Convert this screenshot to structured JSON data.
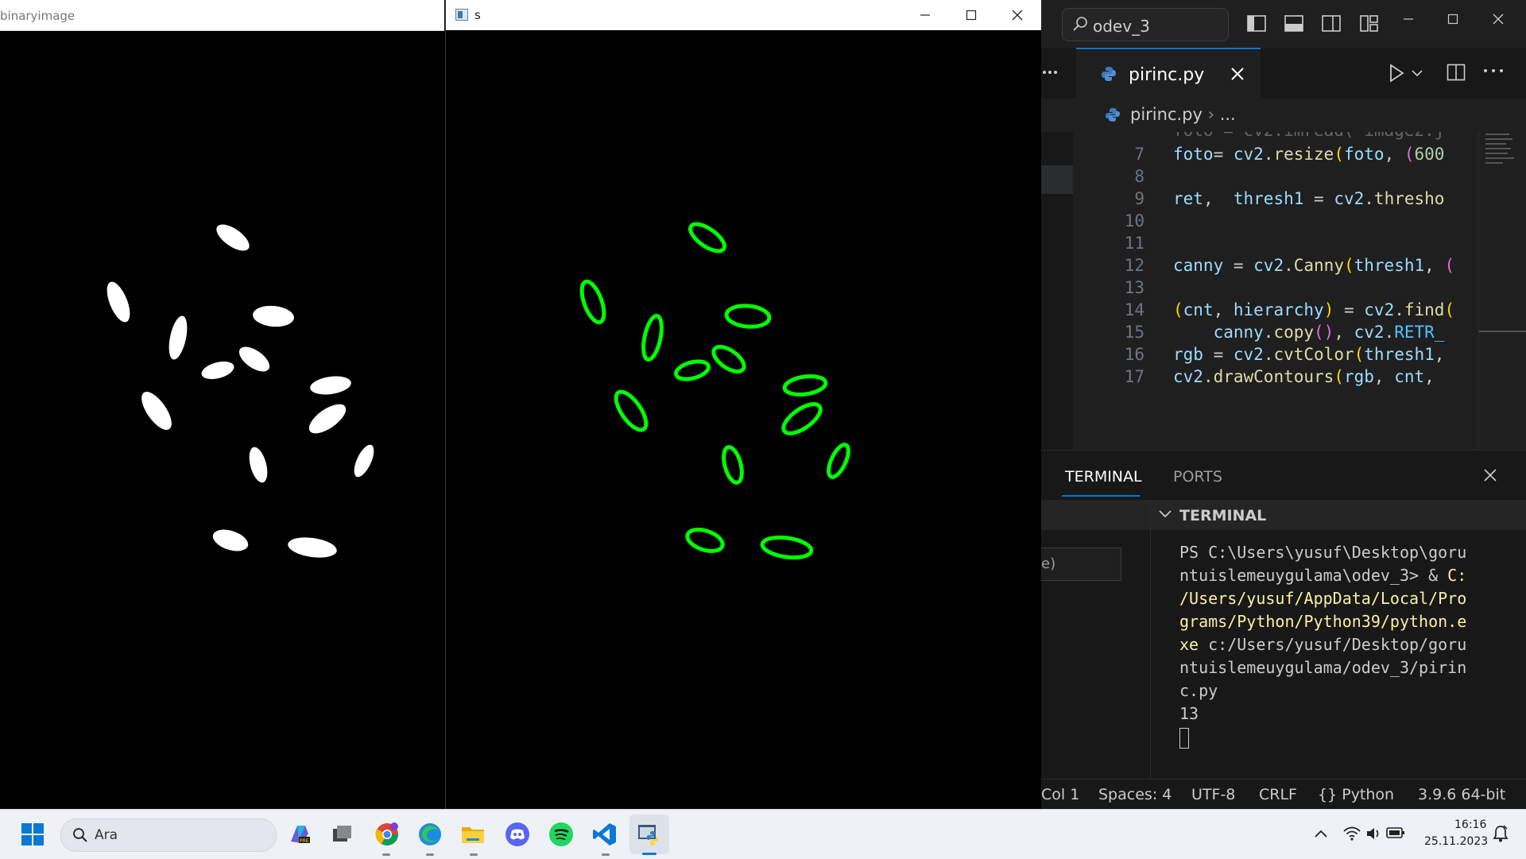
{
  "binary_window": {
    "title": "binaryimage"
  },
  "contour_window": {
    "title": "s"
  },
  "vscode": {
    "search": "odev_3",
    "tab": {
      "label": "pirinc.py"
    },
    "breadcrumb": {
      "file": "pirinc.py",
      "more": "..."
    },
    "code_lines": [
      {
        "num": "7",
        "text": "foto= cv2.resize(foto, (600"
      },
      {
        "num": "8",
        "text": ""
      },
      {
        "num": "9",
        "text": "ret,  thresh1 = cv2.thresho"
      },
      {
        "num": "10",
        "text": ""
      },
      {
        "num": "11",
        "text": ""
      },
      {
        "num": "12",
        "text": "canny = cv2.Canny(thresh1, ("
      },
      {
        "num": "13",
        "text": ""
      },
      {
        "num": "14",
        "text": "(cnt, hierarchy) = cv2.find("
      },
      {
        "num": "15",
        "text": "    canny.copy(), cv2.RETR_"
      },
      {
        "num": "16",
        "text": "rgb = cv2.cvtColor(thresh1,"
      },
      {
        "num": "17",
        "text": "cv2.drawContours(rgb, cnt, "
      }
    ],
    "panel_tabs": [
      "TERMINAL",
      "PORTS"
    ],
    "terminal_header": "TERMINAL",
    "terminal": {
      "l1": "PS C:\\Users\\yusuf\\Desktop\\goru",
      "l2a": "ntuislemeuygulama\\odev_3> & ",
      "l2b": "C:",
      "l3": "/Users/yusuf/AppData/Local/Pro",
      "l4": "grams/Python/Python39/python.e",
      "l5a": "xe",
      "l5b": " c:/Users/yusuf/Desktop/goru",
      "l6": "ntuislemeuygulama/odev_3/pirin",
      "l7": "c.py",
      "l8": "13"
    },
    "side_input": "e)",
    "status": {
      "col": "Col 1",
      "spaces": "Spaces: 4",
      "encoding": "UTF-8",
      "eol": "CRLF",
      "language": "Python",
      "interpreter": "3.9.6 64-bit"
    }
  },
  "taskbar": {
    "search_placeholder": "Ara",
    "time": "16:16",
    "date": "25.11.2023"
  },
  "colors": {
    "accent": "#0078d4",
    "contour": "#00ff00"
  }
}
